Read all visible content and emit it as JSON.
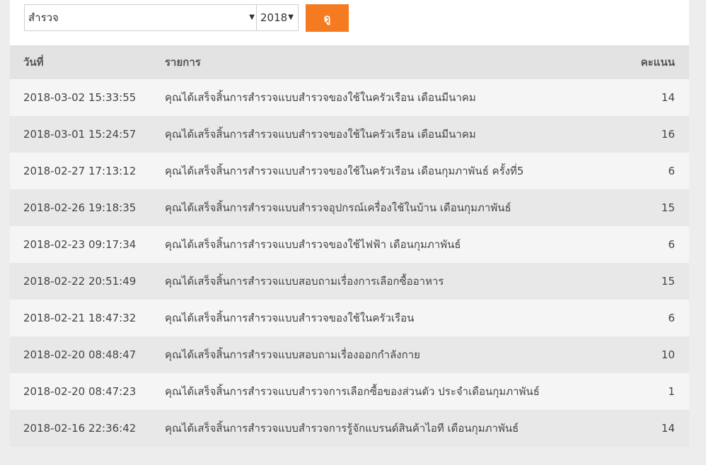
{
  "filters": {
    "type_value": "สำรวจ",
    "year_value": "2018",
    "view_label": "ดู"
  },
  "table": {
    "headers": {
      "date": "วันที่",
      "item": "รายการ",
      "score": "คะแนน"
    },
    "rows": [
      {
        "date": "2018-03-02 15:33:55",
        "item": "คุณได้เสร็จสิ้นการสำรวจแบบสำรวจของใช้ในครัวเรือน เดือนมีนาคม",
        "score": "14"
      },
      {
        "date": "2018-03-01 15:24:57",
        "item": "คุณได้เสร็จสิ้นการสำรวจแบบสำรวจของใช้ในครัวเรือน เดือนมีนาคม",
        "score": "16"
      },
      {
        "date": "2018-02-27 17:13:12",
        "item": "คุณได้เสร็จสิ้นการสำรวจแบบสำรวจของใช้ในครัวเรือน เดือนกุมภาพันธ์ ครั้งที่5",
        "score": "6"
      },
      {
        "date": "2018-02-26 19:18:35",
        "item": "คุณได้เสร็จสิ้นการสำรวจแบบสำรวจอุปกรณ์เครื่องใช้ในบ้าน เดือนกุมภาพันธ์",
        "score": "15"
      },
      {
        "date": "2018-02-23 09:17:34",
        "item": "คุณได้เสร็จสิ้นการสำรวจแบบสำรวจของใช้ไฟฟ้า เดือนกุมภาพันธ์",
        "score": "6"
      },
      {
        "date": "2018-02-22 20:51:49",
        "item": "คุณได้เสร็จสิ้นการสำรวจแบบสอบถามเรื่องการเลือกซื้ออาหาร",
        "score": "15"
      },
      {
        "date": "2018-02-21 18:47:32",
        "item": "คุณได้เสร็จสิ้นการสำรวจแบบสำรวจของใช้ในครัวเรือน",
        "score": "6"
      },
      {
        "date": "2018-02-20 08:48:47",
        "item": "คุณได้เสร็จสิ้นการสำรวจแบบสอบถามเรื่องออกกำลังกาย",
        "score": "10"
      },
      {
        "date": "2018-02-20 08:47:23",
        "item": "คุณได้เสร็จสิ้นการสำรวจแบบสำรวจการเลือกซื้อของส่วนตัว ประจำเดือนกุมภาพันธ์",
        "score": "1"
      },
      {
        "date": "2018-02-16 22:36:42",
        "item": "คุณได้เสร็จสิ้นการสำรวจแบบสำรวจการรู้จักแบรนด์สินค้าไอที เดือนกุมภาพันธ์",
        "score": "14"
      }
    ]
  }
}
